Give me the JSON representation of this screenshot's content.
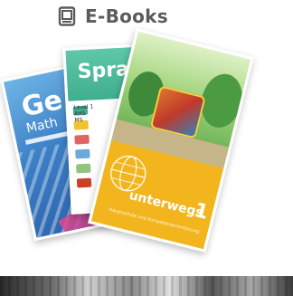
{
  "header": {
    "icon": "ebook-reader-icon",
    "title": "E-Books"
  },
  "books": [
    {
      "cover_title": "Ge",
      "cover_subtitle": "Math",
      "accent": "#3b7fc6"
    },
    {
      "cover_title": "Spra",
      "level_lines": [
        "Level 1",
        "AHS",
        "MS"
      ],
      "accent": "#3fae8f"
    },
    {
      "cover_title": "unterwegs",
      "cover_number": "1",
      "cover_subtitle": "Hauptschule und Kompetenzorientierung",
      "accent": "#f2b51d"
    }
  ],
  "colors": {
    "header_text": "#5b5b5b",
    "background": "#ffffff"
  }
}
